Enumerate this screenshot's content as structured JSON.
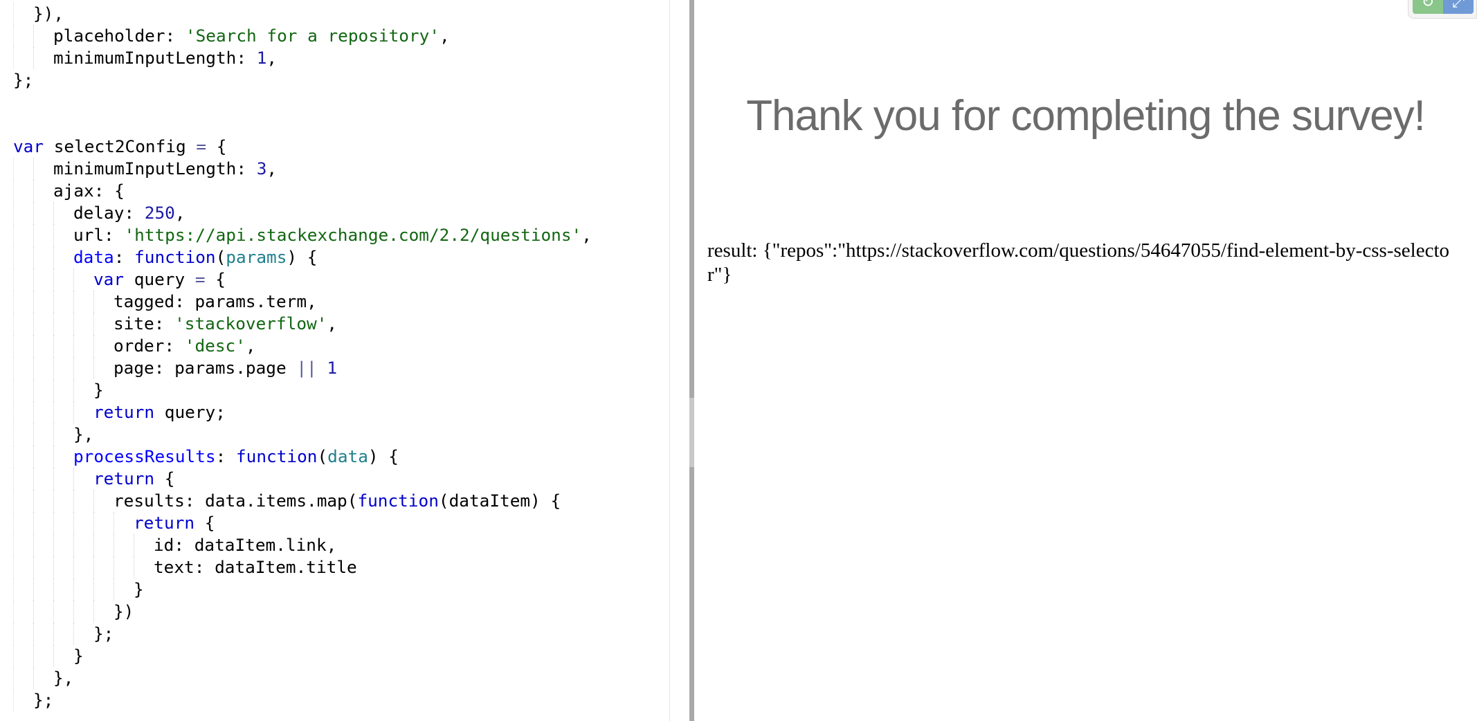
{
  "editor": {
    "lines": [
      [
        {
          "i": 1
        },
        {
          "t": "}),"
        }
      ],
      [
        {
          "i": 2
        },
        {
          "t": "placeholder: "
        },
        {
          "t": "'Search for a repository'",
          "c": "str"
        },
        {
          "t": ","
        }
      ],
      [
        {
          "i": 2
        },
        {
          "t": "minimumInputLength: "
        },
        {
          "t": "1",
          "c": "num"
        },
        {
          "t": ","
        }
      ],
      [
        {
          "i": 0
        },
        {
          "t": "};"
        }
      ],
      [],
      [],
      [
        {
          "i": 0
        },
        {
          "t": "var",
          "c": "kw"
        },
        {
          "t": " select2Config "
        },
        {
          "t": "=",
          "c": "op"
        },
        {
          "t": " {"
        }
      ],
      [
        {
          "i": 2
        },
        {
          "t": "minimumInputLength: "
        },
        {
          "t": "3",
          "c": "num"
        },
        {
          "t": ","
        }
      ],
      [
        {
          "i": 2
        },
        {
          "t": "ajax: {"
        }
      ],
      [
        {
          "i": 3
        },
        {
          "t": "delay: "
        },
        {
          "t": "250",
          "c": "num"
        },
        {
          "t": ","
        }
      ],
      [
        {
          "i": 3
        },
        {
          "t": "url: "
        },
        {
          "t": "'https://api.stackexchange.com/2.2/questions'",
          "c": "str"
        },
        {
          "t": ","
        }
      ],
      [
        {
          "i": 3
        },
        {
          "t": "data",
          "c": "def"
        },
        {
          "t": ": "
        },
        {
          "t": "function",
          "c": "kw"
        },
        {
          "t": "("
        },
        {
          "t": "params",
          "c": "var"
        },
        {
          "t": ") {"
        }
      ],
      [
        {
          "i": 4
        },
        {
          "t": "var",
          "c": "kw"
        },
        {
          "t": " query "
        },
        {
          "t": "=",
          "c": "op"
        },
        {
          "t": " {"
        }
      ],
      [
        {
          "i": 5
        },
        {
          "t": "tagged: params.term,"
        }
      ],
      [
        {
          "i": 5
        },
        {
          "t": "site: "
        },
        {
          "t": "'stackoverflow'",
          "c": "str"
        },
        {
          "t": ","
        }
      ],
      [
        {
          "i": 5
        },
        {
          "t": "order: "
        },
        {
          "t": "'desc'",
          "c": "str"
        },
        {
          "t": ","
        }
      ],
      [
        {
          "i": 5
        },
        {
          "t": "page: params.page "
        },
        {
          "t": "||",
          "c": "op"
        },
        {
          "t": " "
        },
        {
          "t": "1",
          "c": "num"
        }
      ],
      [
        {
          "i": 4
        },
        {
          "t": "}"
        }
      ],
      [
        {
          "i": 4
        },
        {
          "t": "return",
          "c": "kw"
        },
        {
          "t": " query;"
        }
      ],
      [
        {
          "i": 3
        },
        {
          "t": "},"
        }
      ],
      [
        {
          "i": 3
        },
        {
          "t": "processResults",
          "c": "def"
        },
        {
          "t": ": "
        },
        {
          "t": "function",
          "c": "kw"
        },
        {
          "t": "("
        },
        {
          "t": "data",
          "c": "var"
        },
        {
          "t": ") {"
        }
      ],
      [
        {
          "i": 4
        },
        {
          "t": "return",
          "c": "kw"
        },
        {
          "t": " {"
        }
      ],
      [
        {
          "i": 5
        },
        {
          "t": "results: data.items.map("
        },
        {
          "t": "function",
          "c": "kw"
        },
        {
          "t": "(dataItem) {"
        }
      ],
      [
        {
          "i": 6
        },
        {
          "t": "return",
          "c": "kw"
        },
        {
          "t": " {"
        }
      ],
      [
        {
          "i": 7
        },
        {
          "t": "id: dataItem.link,"
        }
      ],
      [
        {
          "i": 7
        },
        {
          "t": "text: dataItem.title"
        }
      ],
      [
        {
          "i": 6
        },
        {
          "t": "}"
        }
      ],
      [
        {
          "i": 5
        },
        {
          "t": "})"
        }
      ],
      [
        {
          "i": 4
        },
        {
          "t": "};"
        }
      ],
      [
        {
          "i": 3
        },
        {
          "t": "}"
        }
      ],
      [
        {
          "i": 2
        },
        {
          "t": "},"
        }
      ],
      [
        {
          "i": 1
        },
        {
          "t": "};"
        }
      ]
    ]
  },
  "result": {
    "heading": "Thank you for completing the survey!",
    "output": "result: {\"repos\":\"https://stackoverflow.com/questions/54647055/find-element-by-css-selector\"}"
  },
  "tools": {
    "refresh_icon": "refresh-icon",
    "expand_icon": "expand-icon",
    "refresh_glyph": "↻",
    "expand_glyph": "⤢"
  },
  "colors": {
    "keyword": "#0000cc",
    "string": "#116611",
    "number": "#1a1aa6",
    "property_def": "#0000ff",
    "variable": "#1f7f8c",
    "heading": "#6b6b6b"
  }
}
